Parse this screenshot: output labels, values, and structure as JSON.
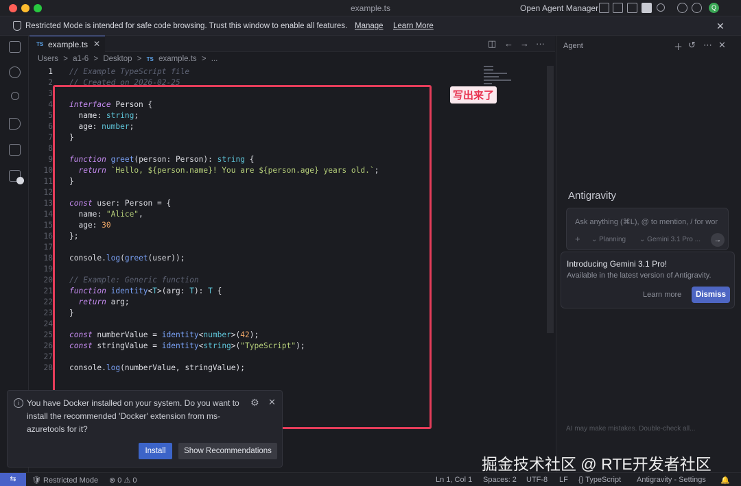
{
  "window": {
    "title": "example.ts",
    "open_agent_manager": "Open Agent Manager",
    "avatar_letter": "Q"
  },
  "banner": {
    "text": "Restricted Mode is intended for safe code browsing. Trust this window to enable all features.",
    "manage": "Manage",
    "learn_more": "Learn More"
  },
  "tab": {
    "badge": "TS",
    "name": "example.ts"
  },
  "breadcrumb": [
    "Users",
    ">",
    "a1-6",
    ">",
    "Desktop",
    ">",
    "TS",
    "example.ts",
    ">",
    "..."
  ],
  "code": {
    "lines": [
      {
        "n": "1",
        "t": "// Example TypeScript file"
      },
      {
        "n": "2",
        "t": "// Created on 2026-02-25"
      },
      {
        "n": "3",
        "t": ""
      },
      {
        "n": "4",
        "t": "interface Person {"
      },
      {
        "n": "5",
        "t": "  name: string;"
      },
      {
        "n": "6",
        "t": "  age: number;"
      },
      {
        "n": "7",
        "t": "}"
      },
      {
        "n": "8",
        "t": ""
      },
      {
        "n": "9",
        "t": "function greet(person: Person): string {"
      },
      {
        "n": "10",
        "t": "  return `Hello, ${person.name}! You are ${person.age} years old.`;"
      },
      {
        "n": "11",
        "t": "}"
      },
      {
        "n": "12",
        "t": ""
      },
      {
        "n": "13",
        "t": "const user: Person = {"
      },
      {
        "n": "14",
        "t": "  name: \"Alice\","
      },
      {
        "n": "15",
        "t": "  age: 30"
      },
      {
        "n": "16",
        "t": "};"
      },
      {
        "n": "17",
        "t": ""
      },
      {
        "n": "18",
        "t": "console.log(greet(user));"
      },
      {
        "n": "19",
        "t": ""
      },
      {
        "n": "20",
        "t": "// Example: Generic function"
      },
      {
        "n": "21",
        "t": "function identity<T>(arg: T): T {"
      },
      {
        "n": "22",
        "t": "  return arg;"
      },
      {
        "n": "23",
        "t": "}"
      },
      {
        "n": "24",
        "t": ""
      },
      {
        "n": "25",
        "t": "const numberValue = identity<number>(42);"
      },
      {
        "n": "26",
        "t": "const stringValue = identity<string>(\"TypeScript\");"
      },
      {
        "n": "27",
        "t": ""
      },
      {
        "n": "28",
        "t": "console.log(numberValue, stringValue);"
      }
    ]
  },
  "annotation": "写出来了",
  "notification": {
    "message": "You have Docker installed on your system. Do you want to install the recommended 'Docker' extension from ms-azuretools for it?",
    "install": "Install",
    "show_recommendations": "Show Recommendations"
  },
  "agent": {
    "header": "Agent",
    "brand": "Antigravity",
    "placeholder": "Ask anything (⌘L), @ to mention, / for wor",
    "mode": "Planning",
    "model": "Gemini 3.1 Pro ...",
    "promo_title": "Introducing Gemini 3.1 Pro!",
    "promo_sub": "Available in the latest version of Antigravity.",
    "learn_more": "Learn more",
    "dismiss": "Dismiss",
    "footer": "AI may make mistakes. Double-check all..."
  },
  "watermark": "掘金技术社区 @ RTE开发者社区",
  "status": {
    "restricted": "Restricted Mode",
    "problems": "⊗ 0 ⚠ 0",
    "position": "Ln 1, Col 1",
    "spaces": "Spaces: 2",
    "encoding": "UTF-8",
    "eol": "LF",
    "language": "{} TypeScript",
    "settings": "Antigravity - Settings"
  },
  "colors": {
    "accent": "#4862c8",
    "highlight_box": "#e53d5a",
    "keyword": "#c58bf0",
    "type": "#5ec4d8",
    "string": "#b6cf7a",
    "number": "#f0a868",
    "comment": "#5c6172",
    "function": "#7aa2f7"
  }
}
